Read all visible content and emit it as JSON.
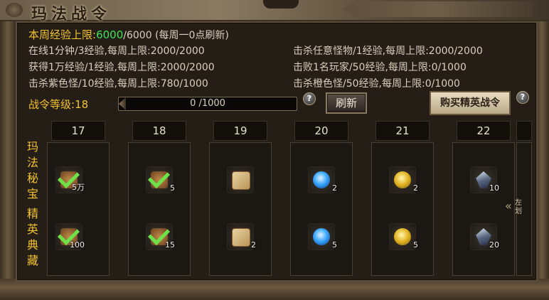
{
  "title": "玛法战令",
  "weekly": {
    "label": "本周经验上限:",
    "current": "6000",
    "rest": "/6000 (每周一0点刷新)"
  },
  "rules": [
    "在线1分钟/3经验,每周上限:2000/2000",
    "击杀任意怪物/1经验,每周上限:2000/2000",
    "获得1万经验/1经验,每周上限:2000/2000",
    "击败1名玩家/50经验,每周上限:0/1000",
    "击杀紫色怪/10经验,每周上限:780/1000",
    "击杀橙色怪/50经验,每周上限:0/1000"
  ],
  "level": {
    "label": "战令等级:",
    "value": "18"
  },
  "progress": {
    "text": "0 /1000",
    "fraction": 0
  },
  "help_glyph": "?",
  "buttons": {
    "refresh": "刷新",
    "buy": "购买精英战令"
  },
  "side_labels": {
    "top": [
      "玛",
      "法",
      "秘",
      "宝"
    ],
    "bottom": [
      "精",
      "英",
      "典",
      "藏"
    ]
  },
  "nav": {
    "arrow": "«",
    "label": "左划"
  },
  "columns": [
    {
      "level": "17",
      "top": {
        "icon": "chest-icon",
        "badge": "5万",
        "claimed": true
      },
      "bottom": {
        "icon": "chest-icon",
        "badge": "100",
        "claimed": true
      }
    },
    {
      "level": "18",
      "top": {
        "icon": "chest-icon",
        "badge": "5",
        "claimed": true
      },
      "bottom": {
        "icon": "chest-icon",
        "badge": "15",
        "claimed": true
      }
    },
    {
      "level": "19",
      "top": {
        "icon": "scroll-icon",
        "badge": "",
        "claimed": false
      },
      "bottom": {
        "icon": "scroll-icon",
        "badge": "2",
        "claimed": false
      }
    },
    {
      "level": "20",
      "top": {
        "icon": "blue-flame-icon",
        "badge": "2",
        "claimed": false
      },
      "bottom": {
        "icon": "blue-flame-icon",
        "badge": "5",
        "claimed": false
      }
    },
    {
      "level": "21",
      "top": {
        "icon": "gold-ore-icon",
        "badge": "2",
        "claimed": false
      },
      "bottom": {
        "icon": "gold-ore-icon",
        "badge": "5",
        "claimed": false
      }
    },
    {
      "level": "22",
      "top": {
        "icon": "crystal-icon",
        "badge": "10",
        "claimed": false
      },
      "bottom": {
        "icon": "crystal-icon",
        "badge": "20",
        "claimed": false
      }
    }
  ]
}
